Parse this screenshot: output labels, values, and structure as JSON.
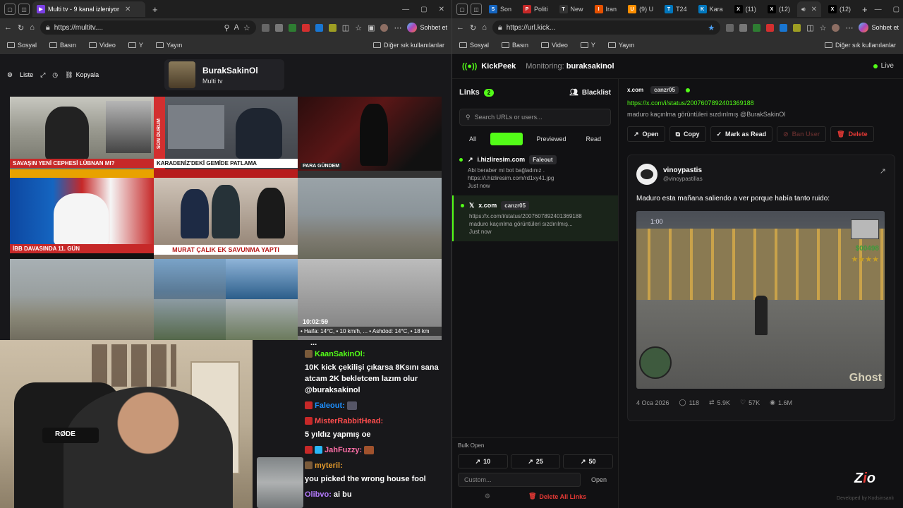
{
  "left_window": {
    "tab_title": "Multi tv - 9 kanal izleniyor",
    "url": "https://multitv....",
    "sohbet": "Sohbet et",
    "bookmarks": [
      "Sosyal",
      "Basın",
      "Video",
      "Y",
      "Yayın"
    ],
    "bookmarks_right": "Diğer sık kullanılanlar"
  },
  "right_window": {
    "tabs": [
      "Son",
      "Politi",
      "New",
      "Iran",
      "(9) U",
      "T24",
      "Kara",
      "(11)",
      "(12)",
      "(12)"
    ],
    "url": "https://url.kick...",
    "sohbet": "Sohbet et",
    "bookmarks": [
      "Sosyal",
      "Basın",
      "Video",
      "Y",
      "Yayın"
    ],
    "bookmarks_right": "Diğer sık kullanılanlar"
  },
  "multitv": {
    "tools": [
      "Liste",
      "Kopyala"
    ],
    "user_name": "BurakSakinOl",
    "user_sub": "Multi tv",
    "captions": {
      "c1": "SAVAŞIN YENİ CEPHESİ LÜBNAN MI?",
      "c2_side": "SON DURUM",
      "c2": "KARADENİZ'DEKİ GEMİDE PATLAMA",
      "c3": "PARA GÜNDEM",
      "c4": "İBB DAVASINDA 11. GÜN",
      "c5": "MURAT ÇALIK EK SAVUNMA YAPTI",
      "c9_time": "10:02:59",
      "c9_weather": "• Haifa: 14°C, • 10 km/h, ... • Ashdod: 14°C, • 18 km"
    },
    "webcam_label": "RØDE"
  },
  "chat": {
    "ellipsis": "...",
    "messages": [
      {
        "user": "KaanSakinOl:",
        "text": "10K kick çekilişi çıkarsa 8Ksını sana atcam 2K bekletcem lazım olur @buraksakinol",
        "color": "#53fc18"
      },
      {
        "user": "Faleout:",
        "text": "",
        "color": "#1e90ff"
      },
      {
        "user": "MisterRabbitHead:",
        "text": "5 yıldız yapmış oe",
        "color": "#ff4d4d"
      },
      {
        "user": "JahFuzzy:",
        "text": "",
        "color": "#ff6fa8"
      },
      {
        "user": "myteril:",
        "text": "you picked the wrong house fool",
        "color": "#e59b2d"
      },
      {
        "user": "Olibvo:",
        "text": "ai bu",
        "color": "#b57bff"
      }
    ]
  },
  "kickpeek": {
    "logo": "KickPeek",
    "monitoring_label": "Monitoring:",
    "monitoring_user": "buraksakinol",
    "live": "Live",
    "links_label": "Links",
    "links_count": "2",
    "blacklist": "Blacklist",
    "search_placeholder": "Search URLs or users...",
    "filters": [
      "All",
      "Unread",
      "Previewed",
      "Read"
    ],
    "items": [
      {
        "domain": "i.hizliresim.com",
        "user": "Faleout",
        "text": "Abi beraber mi bot bağladınız .",
        "url": "https://i.hizliresim.com/rd1xy41.jpg",
        "time": "Just now"
      },
      {
        "domain": "x.com",
        "user": "canzr05",
        "url": "https://x.com/i/status/2007607892401369188",
        "text": "maduro kaçınlma görüntüleri sızdırılmış...",
        "time": "Just now"
      }
    ],
    "bulk_label": "Bulk Open",
    "bulk_buttons": [
      "10",
      "25",
      "50"
    ],
    "custom_placeholder": "Custom...",
    "open": "Open",
    "delete_all": "Delete All Links",
    "detail": {
      "domain": "x.com",
      "user": "canzr05",
      "url": "https://x.com/i/status/2007607892401369188",
      "text": "maduro kaçınlma görüntüleri sızdırılmış @BurakSakinOl",
      "actions": [
        "Open",
        "Copy",
        "Mark as Read",
        "Ban User",
        "Delete"
      ]
    },
    "tweet": {
      "name": "vinoypastis",
      "handle": "@vinoypastillas",
      "text": "Maduro esta mañana saliendo a ver porque había tanto ruido:",
      "hud_time": "1:00",
      "hud_money": "$00498",
      "hud_watermark": "Ghost",
      "date": "4 Oca 2026",
      "replies": "118",
      "retweets": "5.9K",
      "likes": "57K",
      "views": "1.6M"
    },
    "developed": "Developed by Kodsinsanlı"
  }
}
